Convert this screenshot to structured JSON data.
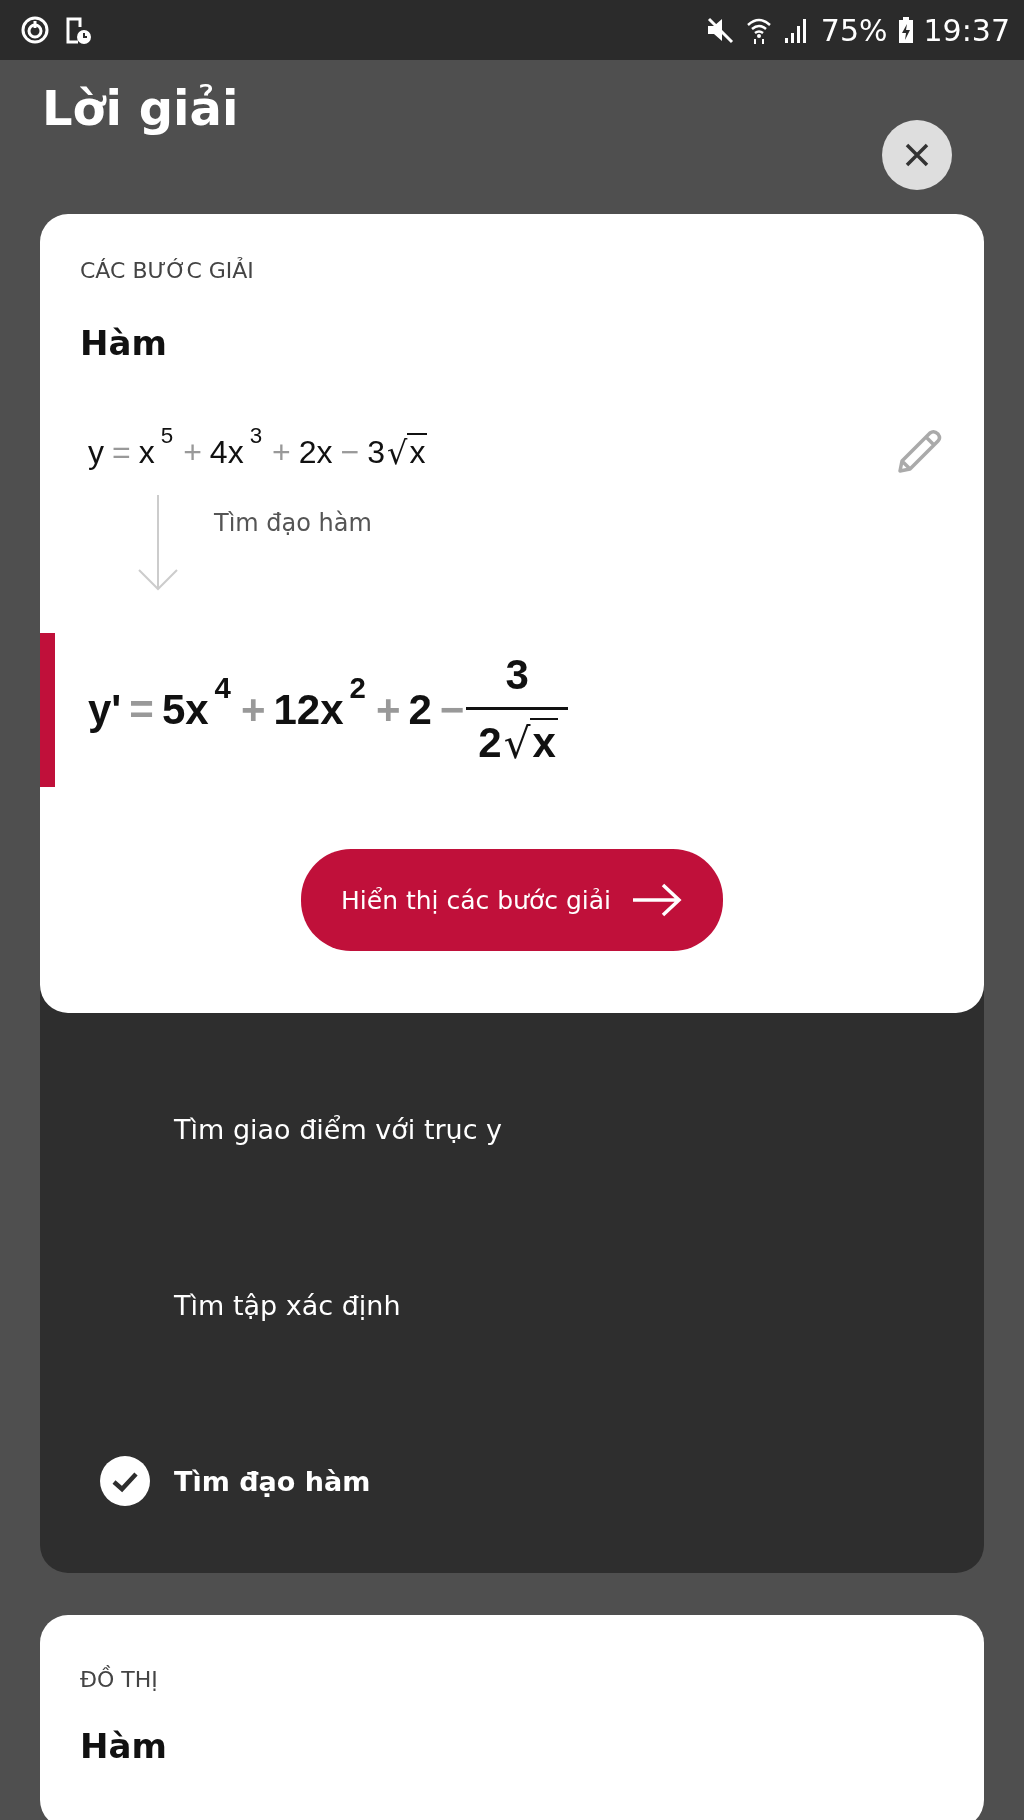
{
  "status_bar": {
    "battery": "75%",
    "time": "19:37"
  },
  "header": {
    "title": "Lời giải"
  },
  "steps_card": {
    "section_label": "CÁC BƯỚC GIẢI",
    "heading": "Hàm",
    "equation": [
      {
        "kind": "term",
        "text": "y"
      },
      {
        "kind": "op",
        "text": "="
      },
      {
        "kind": "term",
        "text": "x"
      },
      {
        "kind": "pow",
        "text": "5"
      },
      {
        "kind": "op",
        "text": "+"
      },
      {
        "kind": "term",
        "text": "4x"
      },
      {
        "kind": "pow",
        "text": "3"
      },
      {
        "kind": "op",
        "text": "+"
      },
      {
        "kind": "term",
        "text": "2x"
      },
      {
        "kind": "op",
        "text": "−"
      },
      {
        "kind": "term",
        "text": "3"
      },
      {
        "kind": "sqrt",
        "radical": "√",
        "text": "x"
      }
    ],
    "step_note": "Tìm đạo hàm",
    "result": [
      {
        "kind": "term",
        "text": "y'"
      },
      {
        "kind": "op",
        "text": "="
      },
      {
        "kind": "term",
        "text": "5x"
      },
      {
        "kind": "pow",
        "text": "4"
      },
      {
        "kind": "op",
        "text": "+"
      },
      {
        "kind": "term",
        "text": "12x"
      },
      {
        "kind": "pow",
        "text": "2"
      },
      {
        "kind": "op",
        "text": "+"
      },
      {
        "kind": "term",
        "text": "2"
      },
      {
        "kind": "op",
        "text": "−"
      },
      {
        "kind": "frac",
        "numerator": "3",
        "denominator": [
          {
            "kind": "term",
            "text": "2"
          },
          {
            "kind": "sqrt",
            "radical": "√",
            "text": "x"
          }
        ]
      }
    ],
    "button": "Hiển thị các bước giải"
  },
  "steps": [
    {
      "label": "Tìm giao điểm với trục y",
      "checked": false
    },
    {
      "label": "Tìm tập xác định",
      "checked": false
    },
    {
      "label": "Tìm đạo hàm",
      "checked": true
    }
  ],
  "graph_card": {
    "section_label": "ĐỒ THỊ",
    "heading": "Hàm"
  }
}
